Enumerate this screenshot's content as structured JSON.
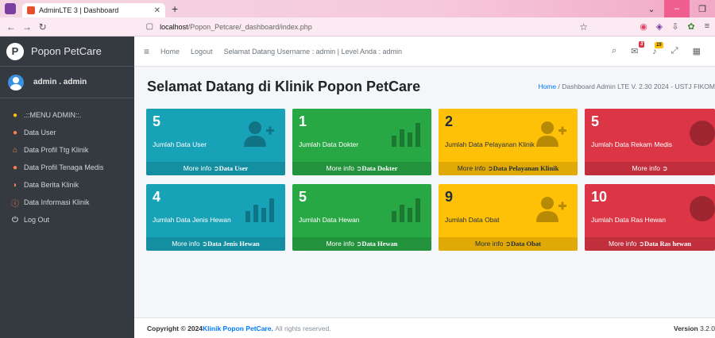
{
  "browser": {
    "tab_title": "AdminLTE 3 | Dashboard",
    "url_host": "localhost",
    "url_path": "/Popon_Petcare/_dashboard/index.php"
  },
  "sidebar": {
    "brand": "Popon PetCare",
    "user": "admin . admin",
    "items": [
      {
        "label": ".::MENU ADMIN::.",
        "icon": "users-gear-icon",
        "color": "#ffc107"
      },
      {
        "label": "Data User",
        "icon": "users-icon",
        "color": "#ff7f50"
      },
      {
        "label": "Data Profil Ttg Klinik",
        "icon": "home-icon",
        "color": "#ff7f50"
      },
      {
        "label": "Data Profil Tenaga Medis",
        "icon": "medic-icon",
        "color": "#ff7f50"
      },
      {
        "label": "Data Berita Klinik",
        "icon": "rss-icon",
        "color": "#ff7f50"
      },
      {
        "label": "Data Informasi Klinik",
        "icon": "info-icon",
        "color": "#ff7f50"
      },
      {
        "label": "Log Out",
        "icon": "power-icon",
        "color": "#ffffff"
      }
    ]
  },
  "topnav": {
    "home": "Home",
    "logout": "Logout",
    "welcome": "Selamat Datang Username : admin | Level Anda : admin",
    "badge_msg": "3",
    "badge_notif": "15"
  },
  "header": {
    "title": "Selamat Datang di Klinik Popon PetCare",
    "breadcrumb_home": "Home",
    "breadcrumb_rest": "Dashboard Admin LTE V. 2.30 2024 - USTJ FIKOM"
  },
  "boxes": [
    {
      "value": "5",
      "label": "Jumlah Data User",
      "more": "More info",
      "link": "Data User",
      "color": "info",
      "icon": "user-plus-icon"
    },
    {
      "value": "1",
      "label": "Jumlah Data Dokter",
      "more": "More info",
      "link": "Data Dokter",
      "color": "success",
      "icon": "bar-chart-icon"
    },
    {
      "value": "2",
      "label": "Jumlah Data Pelayanan Klinik",
      "more": "More info",
      "link": "Data Pelayanan Klinik",
      "color": "warning",
      "icon": "user-plus-icon"
    },
    {
      "value": "5",
      "label": "Jumlah Data Rekam Medis",
      "more": "More info",
      "link": "",
      "color": "danger",
      "icon": "pie-chart-icon"
    },
    {
      "value": "4",
      "label": "Jumlah Data Jenis Hewan",
      "more": "More info",
      "link": "Data Jenis Hewan",
      "color": "info",
      "icon": "bar-chart-icon"
    },
    {
      "value": "5",
      "label": "Jumlah Data Hewan",
      "more": "More info",
      "link": "Data Hewan",
      "color": "success",
      "icon": "bar-chart-icon"
    },
    {
      "value": "9",
      "label": "Jumlah Data Obat",
      "more": "More info",
      "link": "Data Obat",
      "color": "warning",
      "icon": "user-plus-icon"
    },
    {
      "value": "10",
      "label": "Jumlah Data Ras Hewan",
      "more": "More info",
      "link": "Data Ras hewan",
      "color": "danger",
      "icon": "pie-chart-icon"
    }
  ],
  "footer": {
    "copyright": "Copyright © 2024",
    "brand": "Klinik Popon PetCare.",
    "rights": "All rights reserved.",
    "version_label": "Version",
    "version": "3.2.0"
  }
}
